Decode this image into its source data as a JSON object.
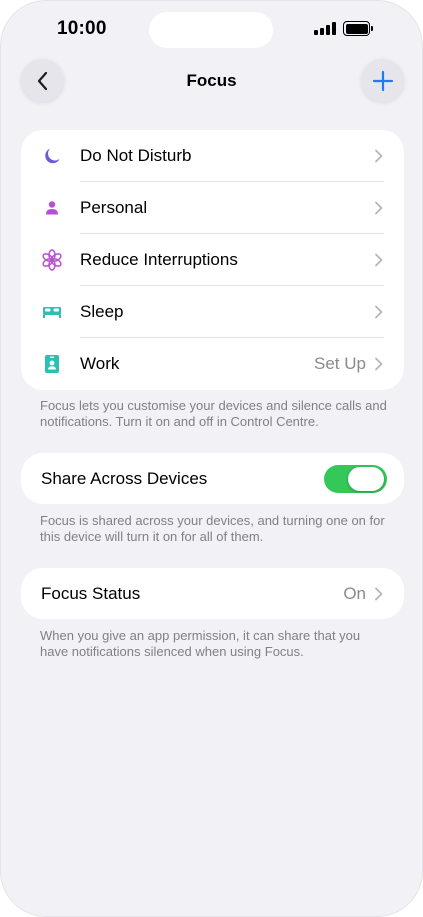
{
  "status_bar": {
    "time": "10:00"
  },
  "nav": {
    "title": "Focus",
    "back_icon": "chevron-left-icon",
    "add_icon": "plus-icon",
    "accent": "#1e7cf2"
  },
  "focus_modes": [
    {
      "label": "Do Not Disturb",
      "value": "",
      "icon": "moon-icon",
      "color": "#6a5ae0"
    },
    {
      "label": "Personal",
      "value": "",
      "icon": "person-icon",
      "color": "#b84fd1"
    },
    {
      "label": "Reduce Interruptions",
      "value": "",
      "icon": "flower-icon",
      "color": "#b84fd1"
    },
    {
      "label": "Sleep",
      "value": "",
      "icon": "bed-icon",
      "color": "#2fbfb2"
    },
    {
      "label": "Work",
      "value": "Set Up",
      "icon": "badge-icon",
      "color": "#2fbfb2"
    }
  ],
  "focus_footnote": "Focus lets you customise your devices and silence calls and notifications. Turn it on and off in Control Centre.",
  "share": {
    "label": "Share Across Devices",
    "enabled": true,
    "toggle_color": "#34c759"
  },
  "share_footnote": "Focus is shared across your devices, and turning one on for this device will turn it on for all of them.",
  "focus_status": {
    "label": "Focus Status",
    "value": "On"
  },
  "status_footnote": "When you give an app permission, it can share that you have notifications silenced when using Focus."
}
